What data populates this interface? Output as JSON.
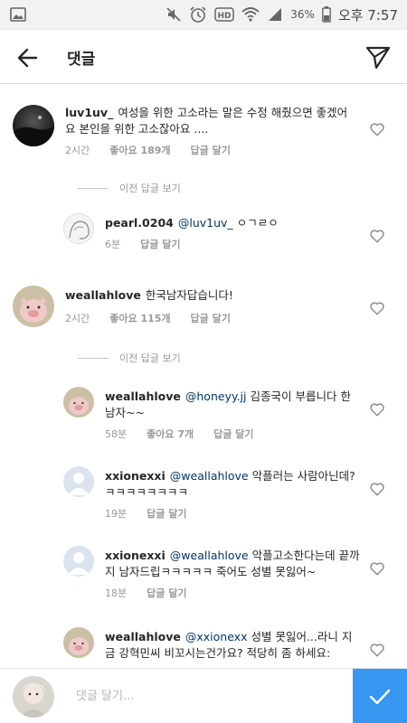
{
  "status_bar": {
    "battery": "36%",
    "time": "오후 7:57",
    "icons": [
      "gallery-icon",
      "mute-icon",
      "alarm-icon",
      "hd-icon",
      "wifi-icon",
      "signal-icon",
      "battery-icon"
    ]
  },
  "header": {
    "title": "댓글",
    "back_icon": "arrow-left-icon",
    "send_icon": "paper-plane-icon"
  },
  "actions": {
    "like": "좋아요",
    "reply": "답글 달기"
  },
  "comments": [
    {
      "username": "luv1uv_",
      "text": "여성을 위한 고소라는 말은 수정 해줬으면 좋겠어요 본인을 위한 고소잖아요 ....",
      "time": "2시간",
      "likes": "좋아요 189개",
      "reply": "답글 달기"
    },
    {
      "view_previous": "이전 답글 보기",
      "username": "pearl.0204",
      "mention": "@luv1uv_",
      "text": "ㅇㄱㄹㅇ",
      "time": "6분",
      "reply": "답글 달기"
    },
    {
      "username": "weallahlove",
      "text": "한국남자답습니다!",
      "time": "2시간",
      "likes": "좋아요 115개",
      "reply": "답글 달기"
    },
    {
      "view_previous": "이전 답글 보기",
      "username": "weallahlove",
      "mention": "@honeyy.jj",
      "text": "김종국이 부릅니다 한남자~~",
      "time": "58분",
      "likes": "좋아요 7개",
      "reply": "답글 달기"
    },
    {
      "username": "xxionexxi",
      "mention": "@weallahlove",
      "text": "악플러는 사람아닌데?ㅋㅋㅋㅋㅋㅋㅋㅋ",
      "time": "19분",
      "reply": "답글 달기"
    },
    {
      "username": "xxionexxi",
      "mention": "@weallahlove",
      "text": "악플고소한다는데 끝까지 남자드립ㅋㅋㅋㅋㅋ 죽어도 성별 못잃어~",
      "time": "18분",
      "reply": "답글 달기"
    },
    {
      "username": "weallahlove",
      "mention": "@xxionexx",
      "text": "성별 못잃어...라니 지금 강혁민씨 비꼬시는건가요? 적당히 좀 하세요:",
      "time": "",
      "reply": ""
    }
  ],
  "composer": {
    "placeholder": "댓글 달기...",
    "submit_icon": "checkmark-icon"
  },
  "colors": {
    "accent": "#3897f0",
    "mention": "#003569",
    "meta": "#999999"
  }
}
